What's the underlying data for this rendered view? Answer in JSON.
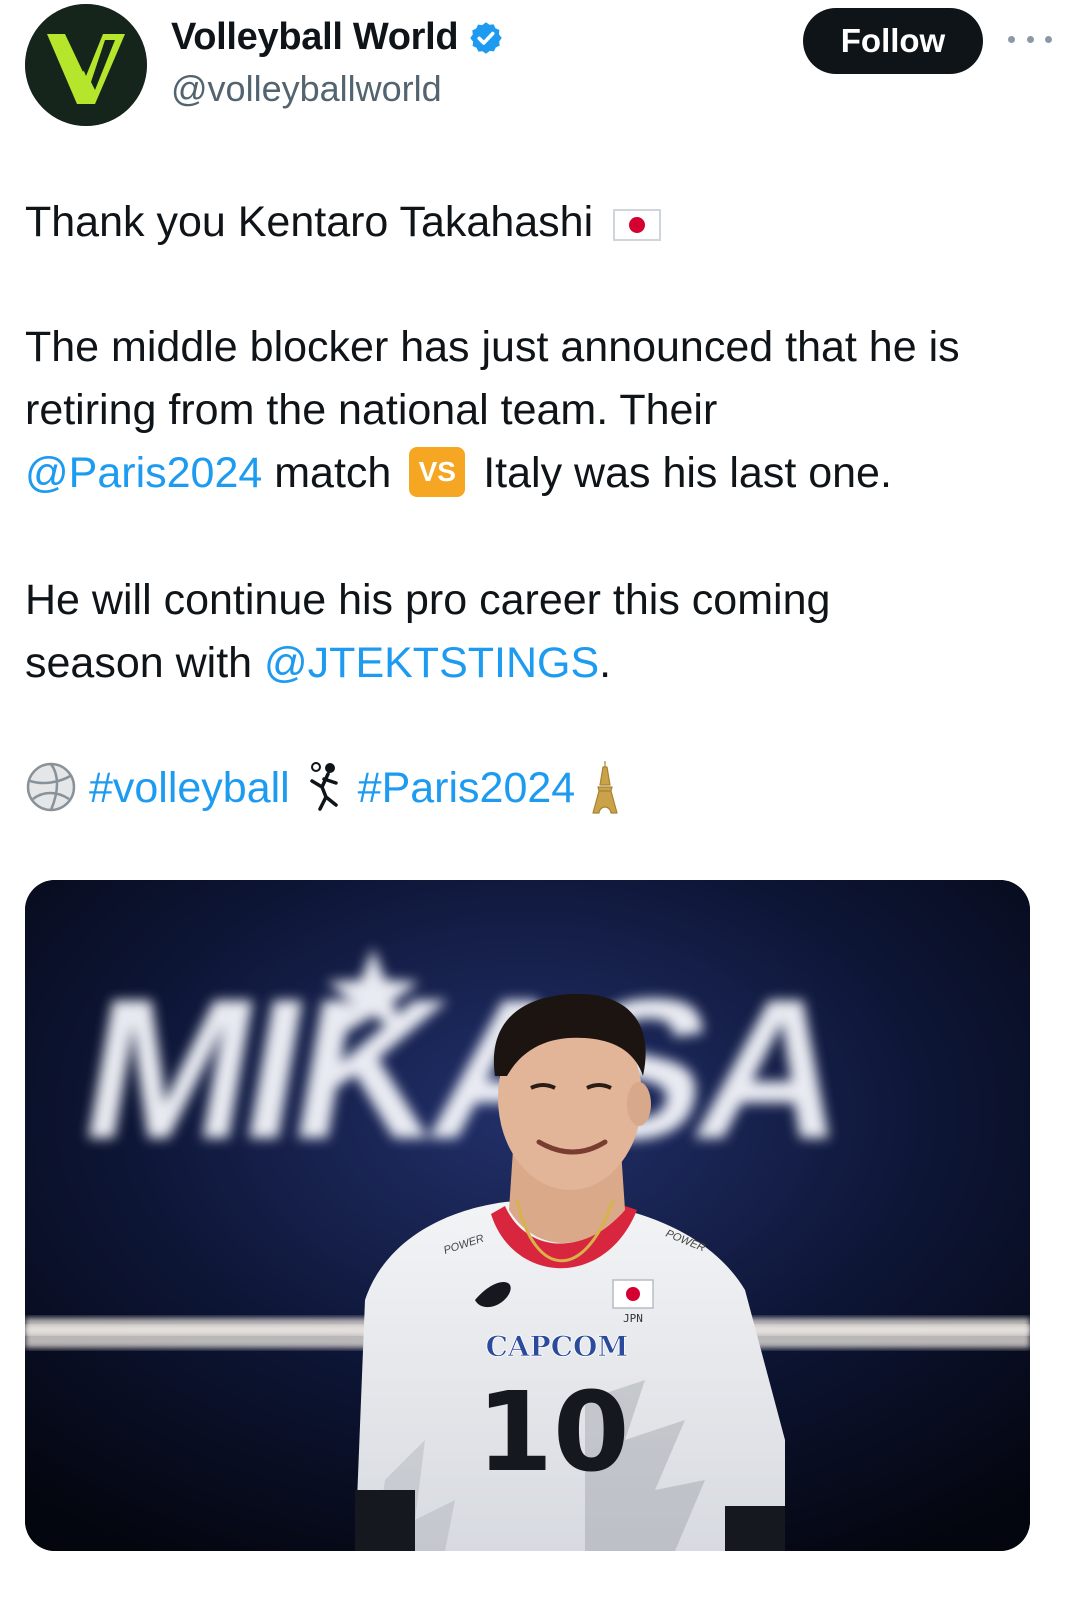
{
  "header": {
    "display_name": "Volleyball World",
    "handle": "@volleyballworld",
    "follow_label": "Follow"
  },
  "tweet": {
    "line1": "Thank you Kentaro Takahashi",
    "line2": "The middle blocker has just announced that he is",
    "line3": "retiring from the national team. Their",
    "line4_mention": "@Paris2024",
    "line4_mid": " match ",
    "vs_label": "VS",
    "line4_end": " Italy was his last one.",
    "line5": "He will continue his pro career this coming",
    "line6_start": "season with ",
    "line6_mention": "@JTEKTSTINGS",
    "line6_end": ".",
    "hashtag1": "#volleyball",
    "hashtag2": "#Paris2024"
  },
  "icons": {
    "verified": "verified-badge-icon",
    "more": "more-options-icon",
    "flag": "japan-flag-icon",
    "volleyball": "volleyball-icon",
    "player": "volleyball-player-icon",
    "tower": "eiffel-tower-icon"
  },
  "media": {
    "banner_text": "MIKASA",
    "jersey_number": "10",
    "jersey_sponsor": "CAPCOM",
    "jersey_country": "JPN",
    "sleeve_text_left": "POWER",
    "sleeve_text_right": "POWER"
  },
  "colors": {
    "link": "#1d9bf0",
    "text": "#0f1419",
    "secondary": "#536471",
    "brand": "#b6e62c",
    "verified": "#1d9bf0"
  }
}
